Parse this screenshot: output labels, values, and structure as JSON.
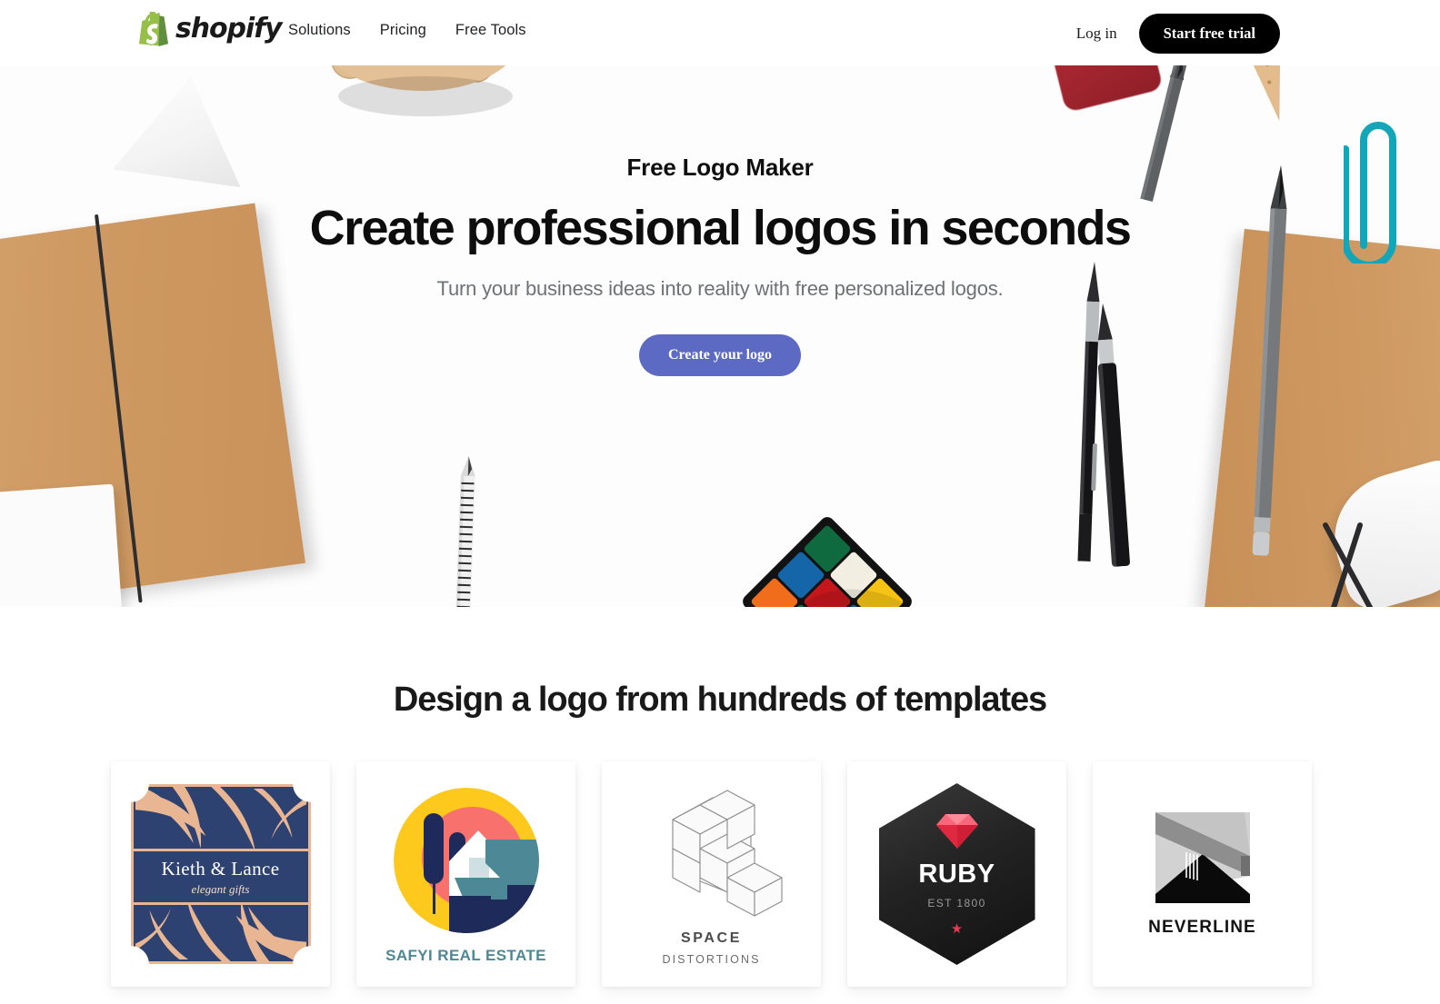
{
  "header": {
    "brand_name": "shopify",
    "brand_icon": "shopify-bag-icon",
    "nav": [
      {
        "label": "Solutions"
      },
      {
        "label": "Pricing"
      },
      {
        "label": "Free Tools"
      }
    ],
    "login_label": "Log in",
    "trial_label": "Start free trial"
  },
  "hero": {
    "eyebrow": "Free Logo Maker",
    "title": "Create professional logos in seconds",
    "subtitle": "Turn your business ideas into reality with free personalized logos.",
    "cta_label": "Create your logo",
    "cta_color": "#5c6ac4",
    "background": "flat-lay desk photo with notebooks, pens, pencils, rubiks cube, wooden hand"
  },
  "templates": {
    "section_title": "Design a logo from hundreds of templates",
    "cards": [
      {
        "id": "kieth-lance",
        "name": "Kieth & Lance",
        "tagline": "elegant gifts",
        "colors": {
          "background": "#2e4272",
          "accent": "#e8b693",
          "text": "#ffffff"
        }
      },
      {
        "id": "safyi-real-estate",
        "name": "SAFYI REAL ESTATE",
        "tagline": "",
        "colors": {
          "sun": "#fdc91d",
          "coral": "#f9716c",
          "teal": "#4d8896",
          "navy": "#1e2a5a",
          "text": "#4d8896"
        }
      },
      {
        "id": "space-distortions",
        "name": "SPACE",
        "tagline": "DISTORTIONS",
        "colors": {
          "line": "#8d8d8d",
          "fill": "#fafafa",
          "text": "#4b4b4b"
        }
      },
      {
        "id": "ruby",
        "name": "RUBY",
        "tagline": "EST 1800",
        "colors": {
          "background": "#1c1c1c",
          "gem": "#ee3b52",
          "text": "#ffffff",
          "sub": "#9a9a9a"
        }
      },
      {
        "id": "neverline",
        "name": "NEVERLINE",
        "tagline": "",
        "colors": {
          "light": "#d2d2d2",
          "mid": "#8e8e8e",
          "dark": "#0a0a0a",
          "text": "#131313"
        }
      }
    ]
  }
}
